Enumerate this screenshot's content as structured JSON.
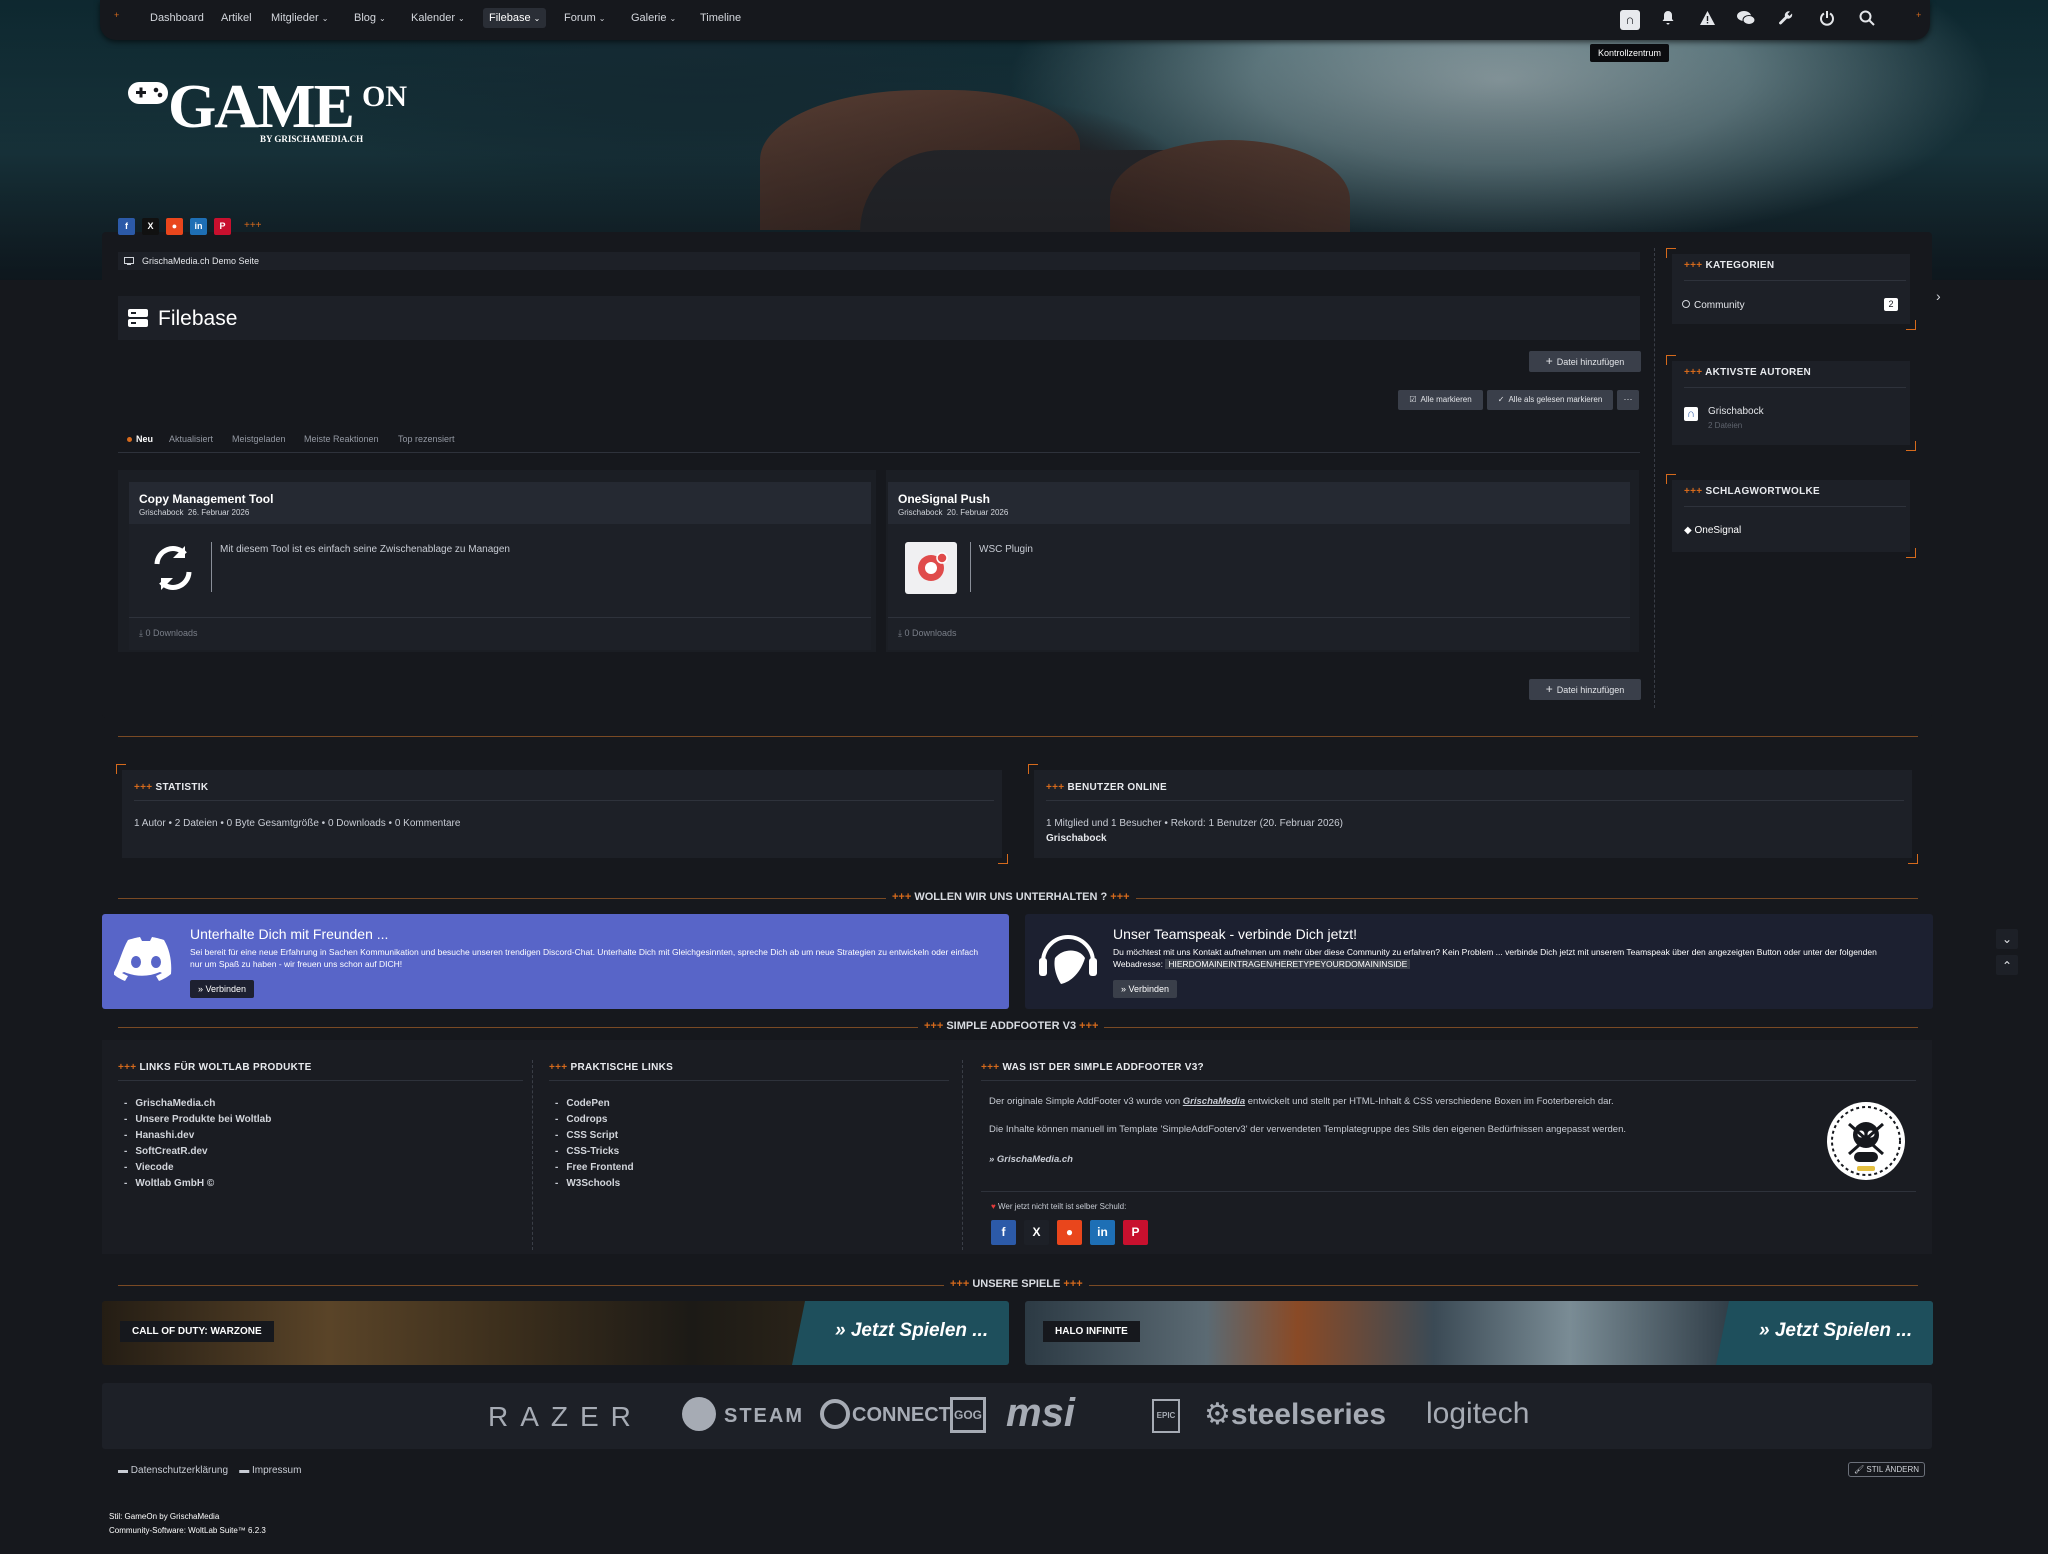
{
  "nav": {
    "items": [
      "Dashboard",
      "Artikel",
      "Mitglieder",
      "Blog",
      "Kalender",
      "Filebase",
      "Forum",
      "Galerie",
      "Timeline"
    ],
    "dropdown": [
      false,
      false,
      true,
      true,
      true,
      true,
      true,
      true,
      false
    ],
    "active": "Filebase",
    "tooltip": "Kontrollzentrum"
  },
  "logo": {
    "main": "GAME",
    "sup": "ON",
    "sub": "BY GRISCHAMEDIA.CH"
  },
  "breadcrumb": "GrischaMedia.ch Demo Seite",
  "page_title": "Filebase",
  "actions": {
    "add_file": "Datei hinzufügen",
    "mark_all": "Alle markieren",
    "mark_read": "Alle als gelesen markieren",
    "more": "···"
  },
  "tabs": [
    "Neu",
    "Aktualisiert",
    "Meistgeladen",
    "Meiste Reaktionen",
    "Top rezensiert"
  ],
  "files": [
    {
      "title": "Copy Management Tool",
      "author": "Grischabock",
      "date": "26. Februar 2026",
      "desc": "Mit diesem Tool ist es einfach seine Zwischenablage zu Managen",
      "downloads": "0 Downloads"
    },
    {
      "title": "OneSignal Push",
      "author": "Grischabock",
      "date": "20. Februar 2026",
      "desc": "WSC Plugin",
      "downloads": "0 Downloads"
    }
  ],
  "sidebar": {
    "categories": {
      "title": "KATEGORIEN",
      "items": [
        {
          "label": "Community",
          "count": "2"
        }
      ]
    },
    "authors": {
      "title": "AKTIVSTE AUTOREN",
      "items": [
        {
          "name": "Grischabock",
          "meta": "2 Dateien"
        }
      ]
    },
    "tags": {
      "title": "SCHLAGWORTWOLKE",
      "items": [
        "OneSignal"
      ]
    }
  },
  "stats": {
    "title": "STATISTIK",
    "items": [
      "1 Autor",
      "2 Dateien",
      "0 Byte Gesamtgröße",
      "0 Downloads",
      "0 Kommentare"
    ]
  },
  "online": {
    "title": "BENUTZER ONLINE",
    "line1": [
      "1 Mitglied und 1 Besucher",
      "Rekord: 1 Benutzer (20. Februar 2026)"
    ],
    "line2": "Grischabock"
  },
  "chat": {
    "heading": "WOLLEN WIR UNS UNTERHALTEN ?",
    "discord": {
      "title": "Unterhalte Dich mit Freunden ...",
      "text": "Sei bereit für eine neue Erfahrung in Sachen Kommunikation und besuche unseren trendigen Discord-Chat. Unterhalte Dich mit Gleichgesinnten, spreche Dich ab um neue Strategien zu entwickeln oder einfach nur um Spaß zu haben - wir freuen uns schon auf DICH!",
      "button": "Verbinden"
    },
    "teamspeak": {
      "title": "Unser Teamspeak - verbinde Dich jetzt!",
      "text": "Du möchtest mit uns Kontakt aufnehmen um mehr über diese Community zu erfahren? Kein Problem ... verbinde Dich jetzt mit unserem Teamspeak über den angezeigten Button oder unter der folgenden Webadresse:",
      "address": "HIERDOMAINEINTRAGEN/HERETYPEYOURDOMAININSIDE",
      "button": "Verbinden"
    }
  },
  "addfooter": {
    "heading": "SIMPLE ADDFOOTER V3",
    "col1": {
      "title": "LINKS FÜR WOLTLAB PRODUKTE",
      "links": [
        "GrischaMedia.ch",
        "Unsere Produkte bei Woltlab",
        "Hanashi.dev",
        "SoftCreatR.dev",
        "Viecode",
        "Woltlab GmbH ©"
      ]
    },
    "col2": {
      "title": "PRAKTISCHE LINKS",
      "links": [
        "CodePen",
        "Codrops",
        "CSS Script",
        "CSS-Tricks",
        "Free Frontend",
        "W3Schools"
      ]
    },
    "col3": {
      "title": "WAS IST DER SIMPLE ADDFOOTER V3?",
      "p1a": "Der originale Simple AddFooter v3 wurde von ",
      "p1b": "GrischaMedia",
      "p1c": " entwickelt und stellt per HTML-Inhalt & CSS verschiedene Boxen im Footerbereich dar.",
      "p2": "Die Inhalte können manuell im Template 'SimpleAddFooterv3' der verwendeten Templategruppe des Stils den eigenen Bedürfnissen angepasst werden.",
      "sig": "» GrischaMedia.ch",
      "share_note": "Wer jetzt nicht teilt ist selber Schuld:"
    }
  },
  "games": {
    "heading": "UNSERE SPIELE",
    "items": [
      {
        "name": "CALL OF DUTY: WARZONE",
        "cta": "Jetzt Spielen ..."
      },
      {
        "name": "HALO INFINITE",
        "cta": "Jetzt Spielen ..."
      }
    ]
  },
  "brands": [
    "RAZER",
    "STEAM",
    "CONNECT",
    "GOG",
    "msi",
    "EPIC",
    "steelseries",
    "logitech"
  ],
  "footer": {
    "links": [
      "Datenschutzerklärung",
      "Impressum"
    ],
    "style_btn": "STIL ÄNDERN",
    "credit1": "Stil: GameOn by GrischaMedia",
    "credit2": "Community-Software: WoltLab Suite™ 6.2.3"
  },
  "colors": {
    "accent": "#d66a1c",
    "discord": "#5865c8",
    "teamspeak": "#1c2030",
    "page": "#16181d",
    "box": "#1d2027"
  }
}
